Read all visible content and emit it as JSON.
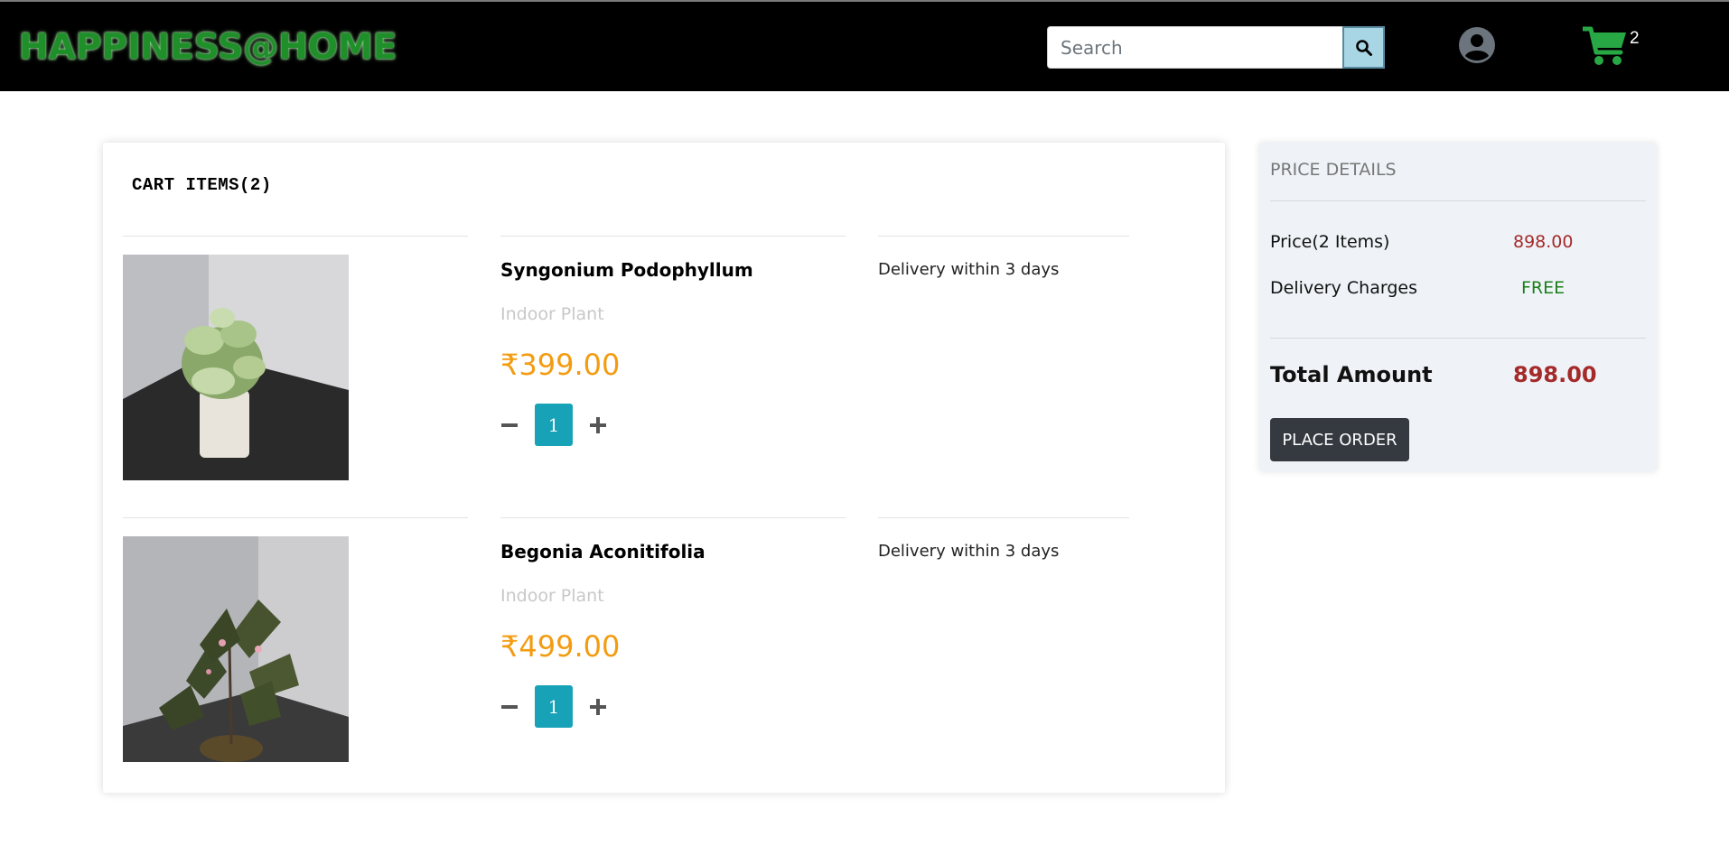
{
  "header": {
    "brand": "HAPPINESS@HOME",
    "search_placeholder": "Search",
    "cart_count": "2"
  },
  "cart": {
    "title": "CART ITEMS(2)",
    "items": [
      {
        "name": "Syngonium Podophyllum",
        "category": "Indoor Plant",
        "price": "₹399.00",
        "quantity": "1",
        "delivery": "Delivery within 3 days",
        "image": "syngonium-plant-photo"
      },
      {
        "name": "Begonia Aconitifolia",
        "category": "Indoor Plant",
        "price": "₹499.00",
        "quantity": "1",
        "delivery": "Delivery within 3 days",
        "image": "begonia-plant-photo"
      }
    ]
  },
  "price_details": {
    "title": "PRICE DETAILS",
    "price_label": "Price(2 Items)",
    "price_value": "898.00",
    "delivery_label": "Delivery Charges",
    "delivery_value": "FREE",
    "total_label": "Total Amount",
    "total_value": "898.00",
    "place_order": "PLACE ORDER"
  },
  "colors": {
    "accent_price": "#f39c12",
    "qty_box": "#17a2b8",
    "amount_red": "#a52a2a",
    "free_green": "#1a7f1a",
    "cart_icon": "#28a745"
  }
}
